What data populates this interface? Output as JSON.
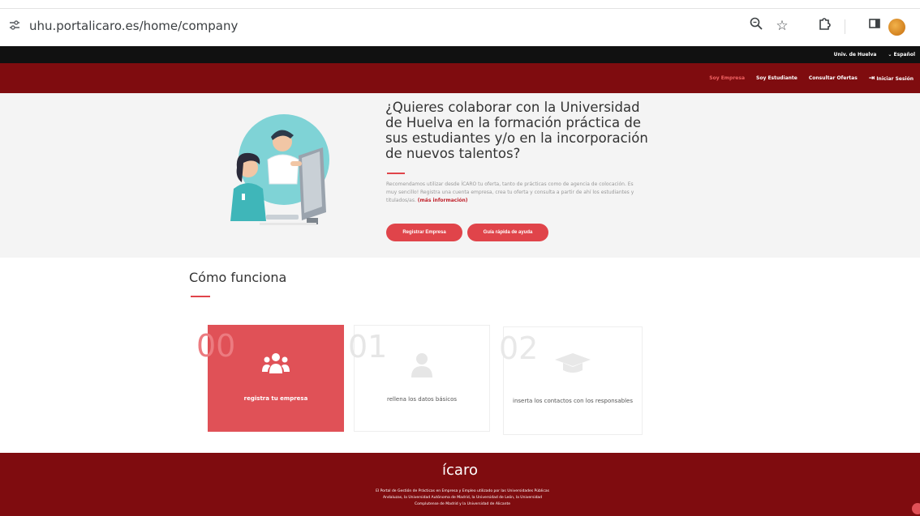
{
  "browser": {
    "url": "uhu.portalicaro.es/home/company",
    "icons": [
      "site-info-icon",
      "zoom-icon",
      "star-icon",
      "extensions-icon",
      "split-view-icon",
      "profile-avatar"
    ]
  },
  "topbar": {
    "language_link": "Univ. de Huelva",
    "language_select": "Español"
  },
  "nav": {
    "items": [
      {
        "label": "Soy Empresa",
        "active": true
      },
      {
        "label": "Soy Estudiante",
        "active": false
      },
      {
        "label": "Consultar Ofertas",
        "active": false
      },
      {
        "label": "Iniciar Sesión",
        "active": false
      }
    ]
  },
  "hero": {
    "title": "¿Quieres colaborar con la Universidad de Huelva en la formación práctica de sus estudiantes y/o en la incorporación de nuevos talentos?",
    "description": "Recomendamos utilizar desde ÍCARO tu oferta, tanto de prácticas como de agencia de colocación. Es muy sencillo! Registra una cuenta empresa, crea tu oferta y consulta a partir de ahí los estudiantes y titulados/as.",
    "more_info": "(más información)",
    "buttons": [
      "Registrar Empresa",
      "Guía rápida de ayuda"
    ]
  },
  "how": {
    "title": "Cómo funciona",
    "steps": [
      {
        "number": "00",
        "label": "registra tu empresa",
        "icon": "group-users-icon"
      },
      {
        "number": "01",
        "label": "rellena los datos básicos",
        "icon": "user-icon"
      },
      {
        "number": "02",
        "label": "inserta los contactos con los responsables",
        "icon": "graduation-cap-icon"
      }
    ]
  },
  "footer": {
    "logo": "ícaro",
    "text": [
      "El Portal de Gestión de Prácticas en Empresa y Empleo utilizado por las Universidades Públicas",
      "Andaluzas, la Universidad Autónoma de Madrid, la Universidad de León, la Universidad",
      "Complutense de Madrid y la Universidad de Alicante"
    ]
  },
  "colors": {
    "brand_red": "#7f0c0f",
    "accent": "#e0444a",
    "card_active": "#e05157"
  }
}
